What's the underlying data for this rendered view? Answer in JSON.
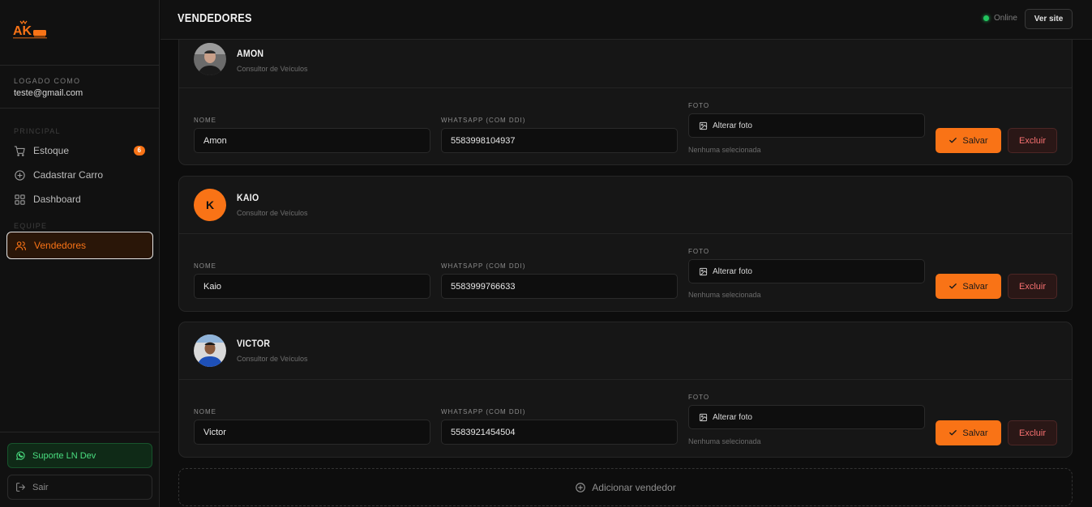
{
  "brand": {
    "logo_text": "AK",
    "accent": "#f97316"
  },
  "sidebar": {
    "logged_label": "LOGADO COMO",
    "email": "teste@gmail.com",
    "sections": {
      "principal": "PRINCIPAL",
      "equipe": "EQUIPE"
    },
    "items": [
      {
        "label": "Estoque",
        "icon": "cart-icon",
        "badge": "6"
      },
      {
        "label": "Cadastrar Carro",
        "icon": "plus-circle-icon"
      },
      {
        "label": "Dashboard",
        "icon": "grid-icon"
      },
      {
        "label": "Vendedores",
        "icon": "users-icon",
        "active": true
      }
    ],
    "support_label": "Suporte LN Dev",
    "logout_label": "Sair"
  },
  "header": {
    "title": "VENDEDORES",
    "status": "Online",
    "status_color": "#22c55e",
    "site_button": "Ver site"
  },
  "form_labels": {
    "name": "NOME",
    "whatsapp": "WHATSAPP (COM DDI)",
    "photo": "FOTO",
    "photo_button": "Alterar foto",
    "photo_note": "Nenhuma selecionada",
    "save": "Salvar",
    "delete": "Excluir"
  },
  "sellers": [
    {
      "display_name": "AMON",
      "role": "Consultor de Veículos",
      "name": "Amon",
      "whatsapp": "5583998104937",
      "avatar": "photo"
    },
    {
      "display_name": "KAIO",
      "role": "Consultor de Veículos",
      "name": "Kaio",
      "whatsapp": "5583999766633",
      "avatar": "initial",
      "initial": "K"
    },
    {
      "display_name": "VICTOR",
      "role": "Consultor de Veículos",
      "name": "Victor",
      "whatsapp": "5583921454504",
      "avatar": "photo"
    }
  ],
  "add_seller": "Adicionar vendedor"
}
